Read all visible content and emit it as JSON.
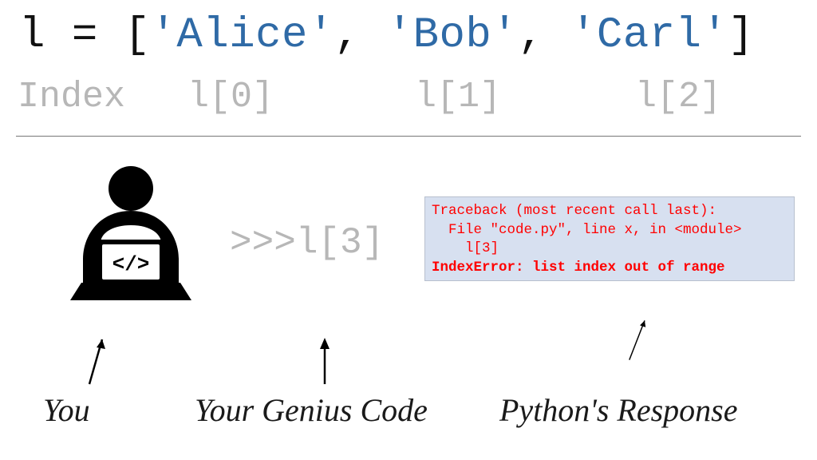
{
  "code": {
    "var": "l",
    "eq": "=",
    "lbr": "[",
    "alice": "'Alice'",
    "c1": ",",
    "bob": "'Bob'",
    "c2": ",",
    "carl": "'Carl'",
    "rbr": "]"
  },
  "index": {
    "label": "Index",
    "i0": "l[0]",
    "i1": "l[1]",
    "i2": "l[2]"
  },
  "genius": {
    "prompt": ">>>",
    "expr": "l[3]"
  },
  "trace": {
    "l1": "Traceback (most recent call last):",
    "l2": "  File \"code.py\", line x, in <module>",
    "l3": "    l[3]",
    "err": "IndexError: list index out of range"
  },
  "captions": {
    "you": "You",
    "genius": "Your Genius Code",
    "python": "Python's Response"
  },
  "colors": {
    "string": "#2f6aa6",
    "faded": "#b7b7b7",
    "error": "#ff0000",
    "traceBg": "#d7e0f0"
  }
}
